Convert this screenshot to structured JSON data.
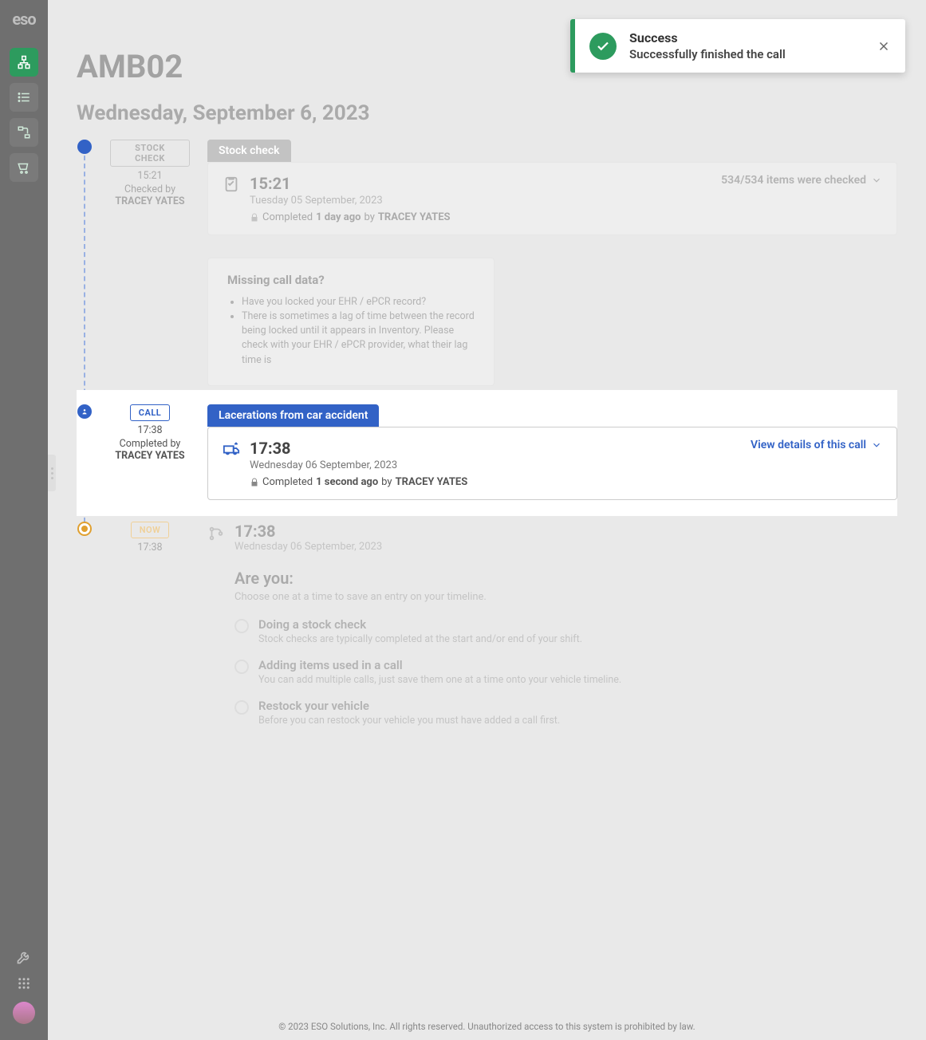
{
  "brand": "eso",
  "toast": {
    "title": "Success",
    "message": "Successfully finished the call"
  },
  "page": {
    "title": "AMB02",
    "date": "Wednesday, September 6, 2023"
  },
  "stock": {
    "badge": "STOCK CHECK",
    "time": "15:21",
    "byLabel": "Checked by",
    "byName": "TRACEY YATES",
    "header": "Stock check",
    "cardTime": "15:21",
    "cardDate": "Tuesday 05 September, 2023",
    "statusPrefix": "Completed ",
    "statusAgo": "1 day ago",
    "statusBy": " by ",
    "statusName": "TRACEY YATES",
    "linkText": "534/534 items were checked"
  },
  "infoBox": {
    "title": "Missing call data?",
    "items": [
      "Have you locked your EHR / ePCR record?",
      "There is sometimes a lag of time between the record being locked until it appears in Inventory. Please check with your EHR / ePCR provider, what their lag time is"
    ]
  },
  "call": {
    "badge": "CALL",
    "time": "17:38",
    "byLabel": "Completed by",
    "byName": "TRACEY YATES",
    "header": "Lacerations from car accident",
    "cardTime": "17:38",
    "cardDate": "Wednesday 06 September, 2023",
    "statusPrefix": "Completed ",
    "statusAgo": "1 second ago",
    "statusBy": " by ",
    "statusName": "TRACEY YATES",
    "linkText": "View details of this call"
  },
  "now": {
    "badge": "NOW",
    "badgeTime": "17:38",
    "time": "17:38",
    "date": "Wednesday 06 September, 2023",
    "promptTitle": "Are you:",
    "promptSub": "Choose one at a time to save an entry on your timeline.",
    "options": [
      {
        "title": "Doing a stock check",
        "desc": "Stock checks are typically completed at the start and/or end of your shift."
      },
      {
        "title": "Adding items used in a call",
        "desc": "You can add multiple calls, just save them one at a time onto your vehicle timeline."
      },
      {
        "title": "Restock your vehicle",
        "desc": "Before you can restock your vehicle you must have added a call first."
      }
    ]
  },
  "footer": "© 2023 ESO Solutions, Inc. All rights reserved. Unauthorized access to this system is prohibited by law."
}
